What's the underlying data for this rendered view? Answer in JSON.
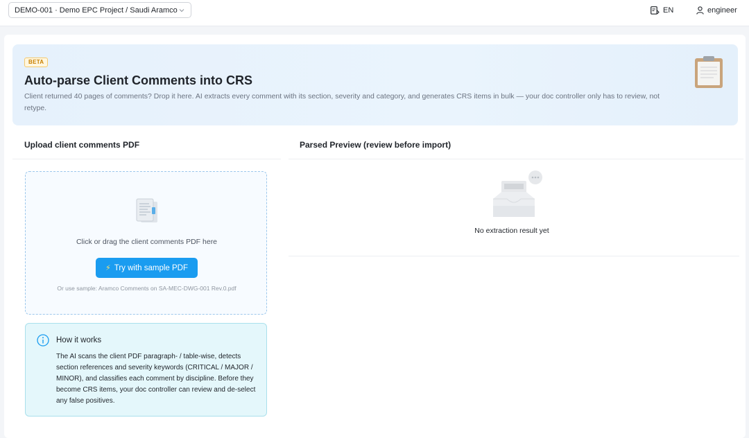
{
  "topbar": {
    "project_select": "DEMO-001 · Demo EPC Project / Saudi Aramco ...",
    "language": "EN",
    "user": "engineer"
  },
  "hero": {
    "badge": "BETA",
    "title": "Auto-parse Client Comments into CRS",
    "description": "Client returned 40 pages of comments? Drop it here. AI extracts every comment with its section, severity and category, and generates CRS items in bulk — your doc controller only has to review, not retype."
  },
  "upload": {
    "heading": "Upload client comments PDF",
    "drop_text": "Click or drag the client comments PDF here",
    "sample_button": "Try with sample PDF",
    "sample_note": "Or use sample: Aramco Comments on SA-MEC-DWG-001 Rev.0.pdf"
  },
  "how_it_works": {
    "title": "How it works",
    "body": "The AI scans the client PDF paragraph- / table-wise, detects section references and severity keywords (CRITICAL / MAJOR / MINOR), and classifies each comment by discipline. Before they become CRS items, your doc controller can review and de-select any false positives."
  },
  "preview": {
    "heading": "Parsed Preview (review before import)",
    "empty_text": "No extraction result yet"
  },
  "colors": {
    "accent": "#1a9cf0",
    "beta_badge": "#c87f00",
    "info_bg": "#e4f7fb"
  }
}
